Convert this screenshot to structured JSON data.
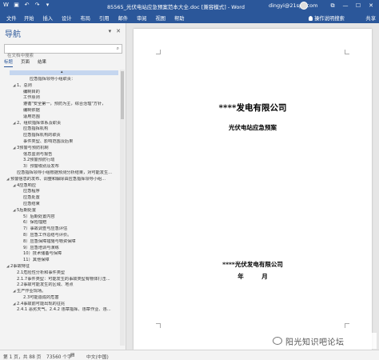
{
  "window": {
    "doc_title": "85565_光伏电站应急预案范本大全.doc [兼容模式] - Word",
    "user": "dingyi@21spv.com",
    "qa_icons": [
      "word-icon",
      "save-icon",
      "undo-icon",
      "redo-icon",
      "customize-icon"
    ],
    "controls": {
      "restore": "⧉",
      "minimize": "—",
      "maximize": "☐",
      "close": "✕"
    }
  },
  "ribbon": {
    "tabs": [
      "文件",
      "开始",
      "插入",
      "设计",
      "布局",
      "引用",
      "邮件",
      "审阅",
      "视图",
      "帮助"
    ],
    "search_label": "操作说明搜索",
    "share_label": "共享"
  },
  "nav": {
    "title": "导航",
    "search_placeholder": "在文档中搜索",
    "tabs": [
      "标题",
      "页面",
      "结果"
    ],
    "highlight_glyph": "▴",
    "items": [
      {
        "text": "应急指挥领导小组职责：",
        "indent": 3,
        "arrow": ""
      },
      {
        "text": "1、总则",
        "indent": 1,
        "arrow": "◢"
      },
      {
        "text": "编制目的",
        "indent": 2,
        "arrow": ""
      },
      {
        "text": "工作原则",
        "indent": 2,
        "arrow": ""
      },
      {
        "text": "遵循\"安全第一，预防为主，综合治理\"方针，",
        "indent": 2,
        "arrow": ""
      },
      {
        "text": "编制依据",
        "indent": 2,
        "arrow": ""
      },
      {
        "text": "适用范围",
        "indent": 2,
        "arrow": ""
      },
      {
        "text": "2、组织指挥体系及职责",
        "indent": 1,
        "arrow": "◢"
      },
      {
        "text": "应急指挥机构",
        "indent": 2,
        "arrow": ""
      },
      {
        "text": "应急指挥机构的职责",
        "indent": 2,
        "arrow": ""
      },
      {
        "text": "事件类型、影响范围及后果",
        "indent": 2,
        "arrow": ""
      },
      {
        "text": "3预警与预防机制",
        "indent": 1,
        "arrow": "◢"
      },
      {
        "text": "信息监测与报告",
        "indent": 2,
        "arrow": ""
      },
      {
        "text": "3.2预警预防行动",
        "indent": 2,
        "arrow": ""
      },
      {
        "text": "3）预警级别及发布",
        "indent": 2,
        "arrow": ""
      },
      {
        "text": "应急指挥领导小组根据预测分析结果，对可能发生...",
        "indent": 1,
        "arrow": ""
      },
      {
        "text": "预警信息的发布、调整和解除由应急指挥领导小组...",
        "indent": 0,
        "arrow": "◢"
      },
      {
        "text": "4应急响应",
        "indent": 1,
        "arrow": "◢"
      },
      {
        "text": "应急程序",
        "indent": 2,
        "arrow": ""
      },
      {
        "text": "应急处置",
        "indent": 2,
        "arrow": ""
      },
      {
        "text": "应急结束",
        "indent": 2,
        "arrow": ""
      },
      {
        "text": "5后期处置",
        "indent": 1,
        "arrow": "◢"
      },
      {
        "text": "5）后期处置内容",
        "indent": 2,
        "arrow": ""
      },
      {
        "text": "6）保险理赔",
        "indent": 2,
        "arrow": ""
      },
      {
        "text": "7）事故调查与应急评估",
        "indent": 2,
        "arrow": ""
      },
      {
        "text": "8）应急工作总结与评价。",
        "indent": 2,
        "arrow": ""
      },
      {
        "text": "8）应急保障措施与物资保障",
        "indent": 2,
        "arrow": ""
      },
      {
        "text": "9）应急培训与演练",
        "indent": 2,
        "arrow": ""
      },
      {
        "text": "10）技术储备与保障",
        "indent": 2,
        "arrow": ""
      },
      {
        "text": "11）其他保障",
        "indent": 2,
        "arrow": ""
      },
      {
        "text": "2事故特征",
        "indent": 0,
        "arrow": "◢"
      },
      {
        "text": "2.1危险性分析和事件类型",
        "indent": 1,
        "arrow": ""
      },
      {
        "text": "2.1.7事件类型：可能发生的事故类型有物体打击...",
        "indent": 1,
        "arrow": ""
      },
      {
        "text": "2.2事故可能发生的区域、地点",
        "indent": 1,
        "arrow": ""
      },
      {
        "text": "生产作业现场。",
        "indent": 1,
        "arrow": "◢"
      },
      {
        "text": "2.3可能造成的危害",
        "indent": 2,
        "arrow": ""
      },
      {
        "text": "2.4事故前可能出现的征兆",
        "indent": 1,
        "arrow": "◢"
      },
      {
        "text": "2.4.1 恶劣天气、2.4.2 违章指挥、违章作业、违...",
        "indent": 1,
        "arrow": ""
      }
    ]
  },
  "document": {
    "company": "****发电有限公司",
    "plan_title": "光伏电站应急预案",
    "company_footer": "****光伏发电有限公司",
    "date_line": "年 月"
  },
  "status": {
    "page": "第 1 页，共 88 页",
    "words": "73560 个字",
    "proofing_icon": "proofing-icon",
    "language": "中文(中国)"
  },
  "watermark": {
    "text": "阳光知识吧论坛"
  },
  "colors": {
    "titlebar": "#2b579a",
    "nav_bg": "#f3f3f3",
    "highlight": "#c5d6ef"
  }
}
